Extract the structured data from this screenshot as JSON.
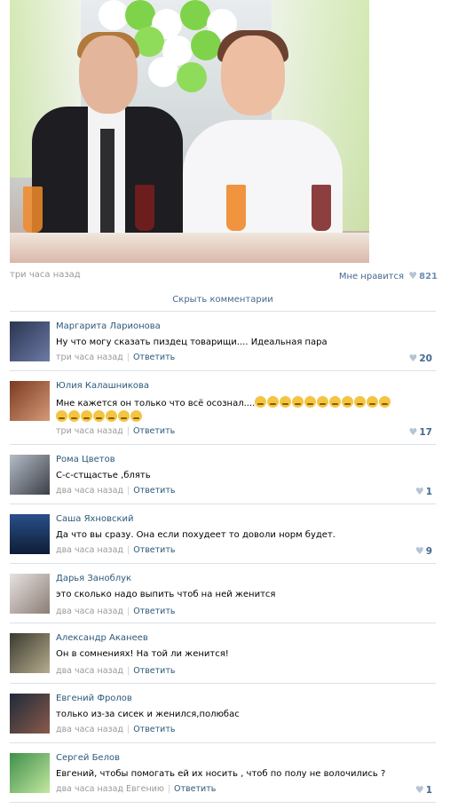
{
  "post": {
    "time": "три часа назад",
    "like_label": "Мне нравится",
    "like_count": "821",
    "hide_comments": "Скрыть комментарии"
  },
  "colors": {
    "link": "#2b587a",
    "muted": "#999999",
    "separator": "#dae1e8"
  },
  "icons": {
    "like": "heart-icon"
  },
  "comments": [
    {
      "author": "Маргарита Ларионова",
      "text": "Ну что могу сказать пиздец товарищи.... Идеальная пара",
      "time": "три часа назад",
      "reply": "Ответить",
      "likes": "20"
    },
    {
      "author": "Юлия Калашникова",
      "text": "Мне кажется он только что всё осознал....",
      "emoji_count": 18,
      "time": "три часа назад",
      "reply": "Ответить",
      "likes": "17"
    },
    {
      "author": "Рома Цветов",
      "text": "С-с-стщастье ,блять",
      "time": "два часа назад",
      "reply": "Ответить",
      "likes": "1"
    },
    {
      "author": "Саша Яхновский",
      "text": "Да что вы сразу. Она если похудеет то доволи норм будет.",
      "time": "два часа назад",
      "reply": "Ответить",
      "likes": "9"
    },
    {
      "author": "Дарья Заноблук",
      "text": "это сколько надо выпить чтоб на ней женится",
      "time": "два часа назад",
      "reply": "Ответить",
      "likes": ""
    },
    {
      "author": "Александр Аканеев",
      "text": "Он в сомнениях! На той ли женится!",
      "time": "два часа назад",
      "reply": "Ответить",
      "likes": ""
    },
    {
      "author": "Евгений Фролов",
      "text": "только из-за сисек и женился,полюбас",
      "time": "два часа назад",
      "reply": "Ответить",
      "likes": ""
    },
    {
      "author": "Сергей Белов",
      "text": "Евгений, чтобы помогать ей их носить , чтоб по полу не волочились ?",
      "time": "два часа назад Евгению",
      "reply": "Ответить",
      "likes": "1"
    }
  ]
}
